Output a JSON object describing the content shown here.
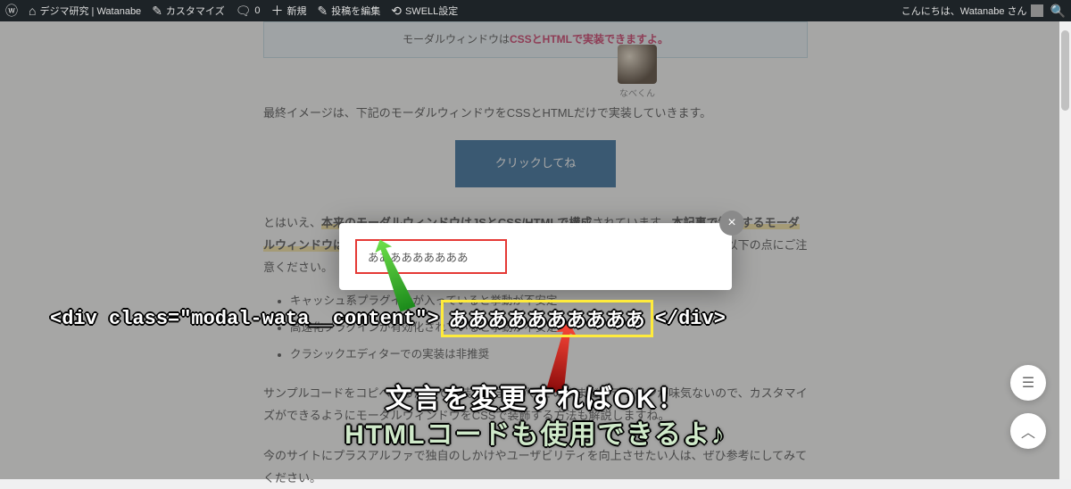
{
  "adminbar": {
    "site_title": "デジマ研究 | Watanabe",
    "customize": "カスタマイズ",
    "comments_count": "0",
    "new": "新規",
    "edit_post": "投稿を編集",
    "swell": "SWELL設定",
    "greeting": "こんにちは、Watanabe さん"
  },
  "page": {
    "notice_prefix": "モーダルウィンドウは",
    "notice_highlight": "CSSとHTMLで実装できますよ。",
    "avatar_caption": "なべくん",
    "para1": "最終イメージは、下記のモーダルウィンドウをCSSとHTMLだけで実装していきます。",
    "cta": "クリックしてね",
    "para2_a": "とはいえ、",
    "para2_b": "本来のモーダルウィンドウはJSとCSS/HTMLで構成",
    "para2_c": "されています。",
    "para2_d": "本記事で解説するモーダルウィンドウは実装の手間を少なくし、カスタマイズのしやすさを重視した内容",
    "para2_e": "となり、以下の点にご注意ください。",
    "bullets": [
      "キャッシュ系プラグインが入っていると挙動が不安定",
      "高速化プラグインが有効化されていると挙動が不安定",
      "クラシックエディターでの実装は非推奨"
    ],
    "para3": "サンプルコードをコピペするだけで実装できますが、そのままだとデザインが味気ないので、カスタマイズができるようにモーダルウィンドウをCSSで装飾する方法も解説しますね。",
    "para4": "今のサイトにプラスアルファで独自のしかけやユーザビリティを向上させたい人は、ぜひ参考にしてみてください。"
  },
  "modal": {
    "content": "あああああああああ"
  },
  "annotations": {
    "code_before": "<div class=\"modal-wata__content\">",
    "code_highlight": "ああああああああああ",
    "code_after": "</div>",
    "line1": "文言を変更すればOK！",
    "line2": "HTMLコードも使用できるよ♪"
  }
}
